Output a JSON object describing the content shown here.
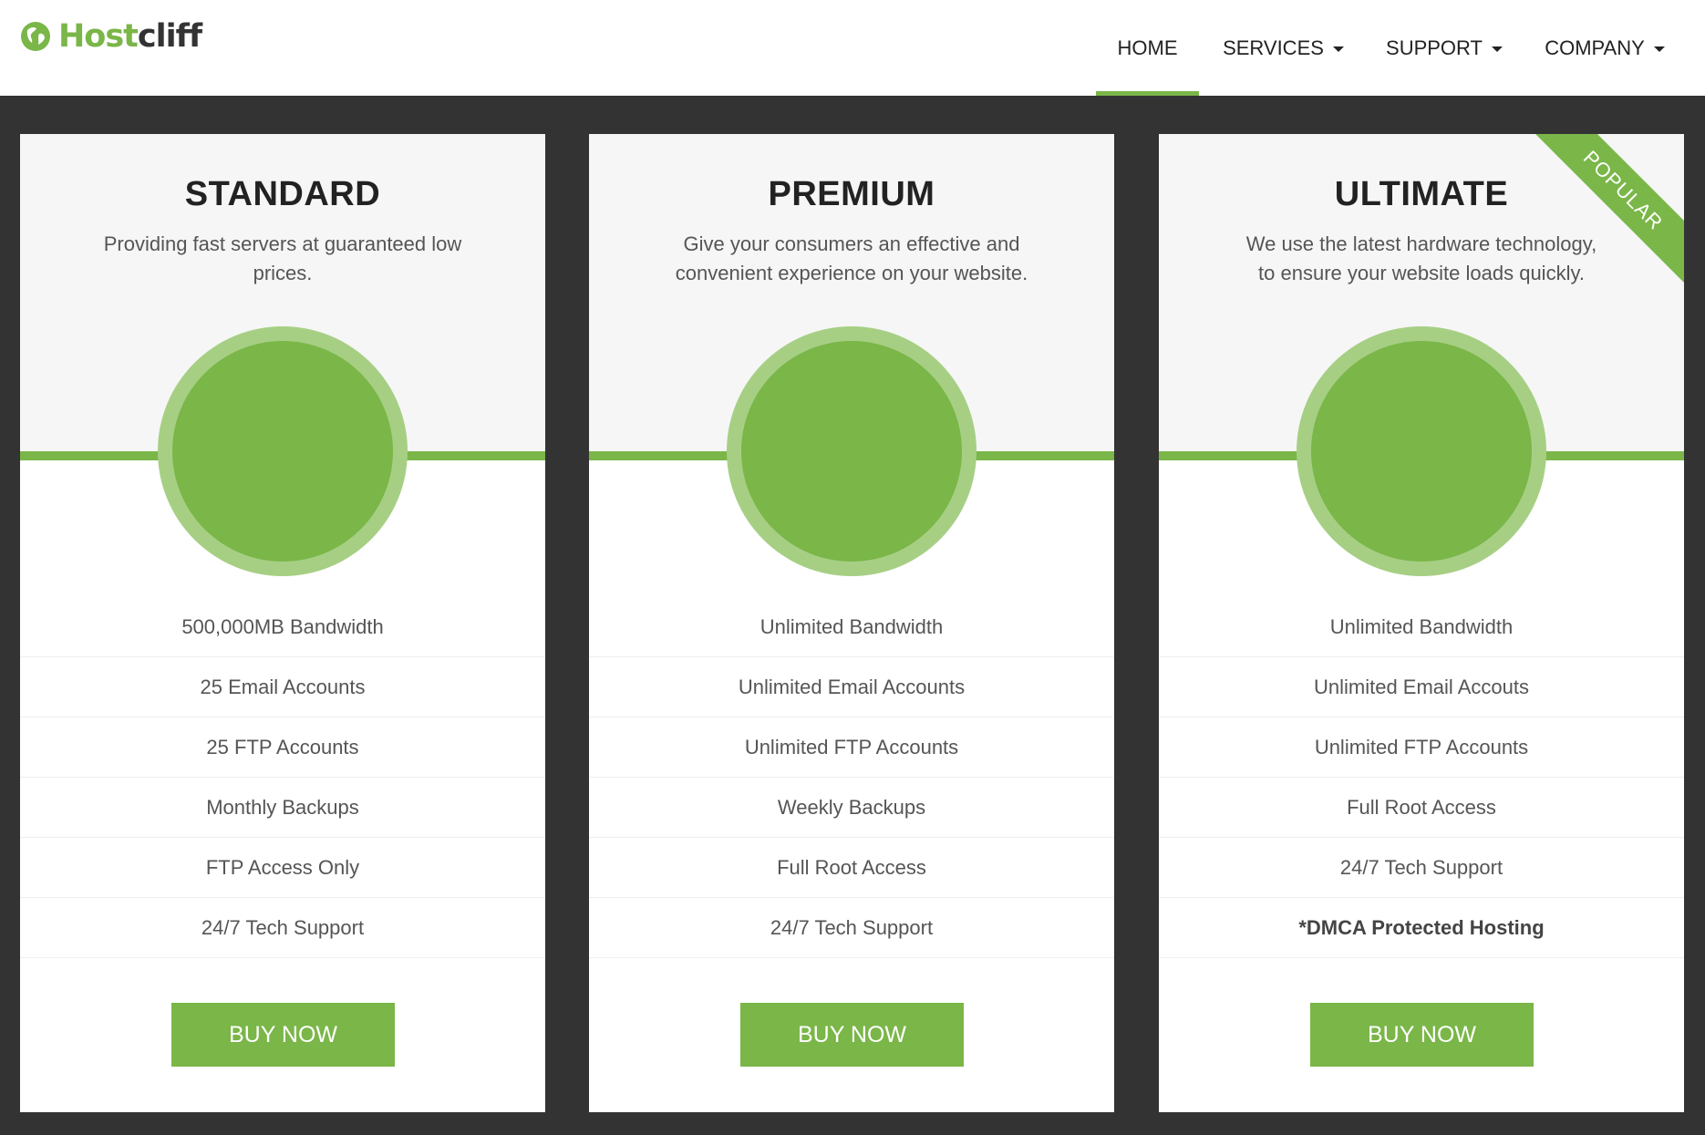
{
  "brand": {
    "name_part1": "Host",
    "name_part2": "cliff",
    "accent": "#7ab648"
  },
  "nav": {
    "home": "HOME",
    "services": "SERVICES",
    "support": "SUPPORT",
    "company": "COMPANY",
    "active": "HOME"
  },
  "plans": [
    {
      "name": "STANDARD",
      "description": "Providing fast servers at guaranteed low prices.",
      "features": [
        "500,000MB Bandwidth",
        "25 Email Accounts",
        "25 FTP Accounts",
        "Monthly Backups",
        "FTP Access Only",
        "24/7 Tech Support"
      ],
      "button": "BUY NOW"
    },
    {
      "name": "PREMIUM",
      "description": "Give your consumers an effective and convenient experience on your website.",
      "features": [
        "Unlimited Bandwidth",
        "Unlimited Email Accounts",
        "Unlimited FTP Accounts",
        "Weekly Backups",
        "Full Root Access",
        "24/7 Tech Support"
      ],
      "button": "BUY NOW"
    },
    {
      "name": "ULTIMATE",
      "description": "We use the latest hardware technology, to ensure your website loads quickly.",
      "features": [
        "Unlimited Bandwidth",
        "Unlimited Email Accouts",
        "Unlimited FTP Accounts",
        "Full Root Access",
        "24/7 Tech Support",
        "*DMCA Protected Hosting"
      ],
      "button": "BUY NOW",
      "ribbon": "POPULAR"
    }
  ],
  "colors": {
    "accent": "#7ab648",
    "accent_light": "#a6cf84",
    "background": "#333333"
  }
}
